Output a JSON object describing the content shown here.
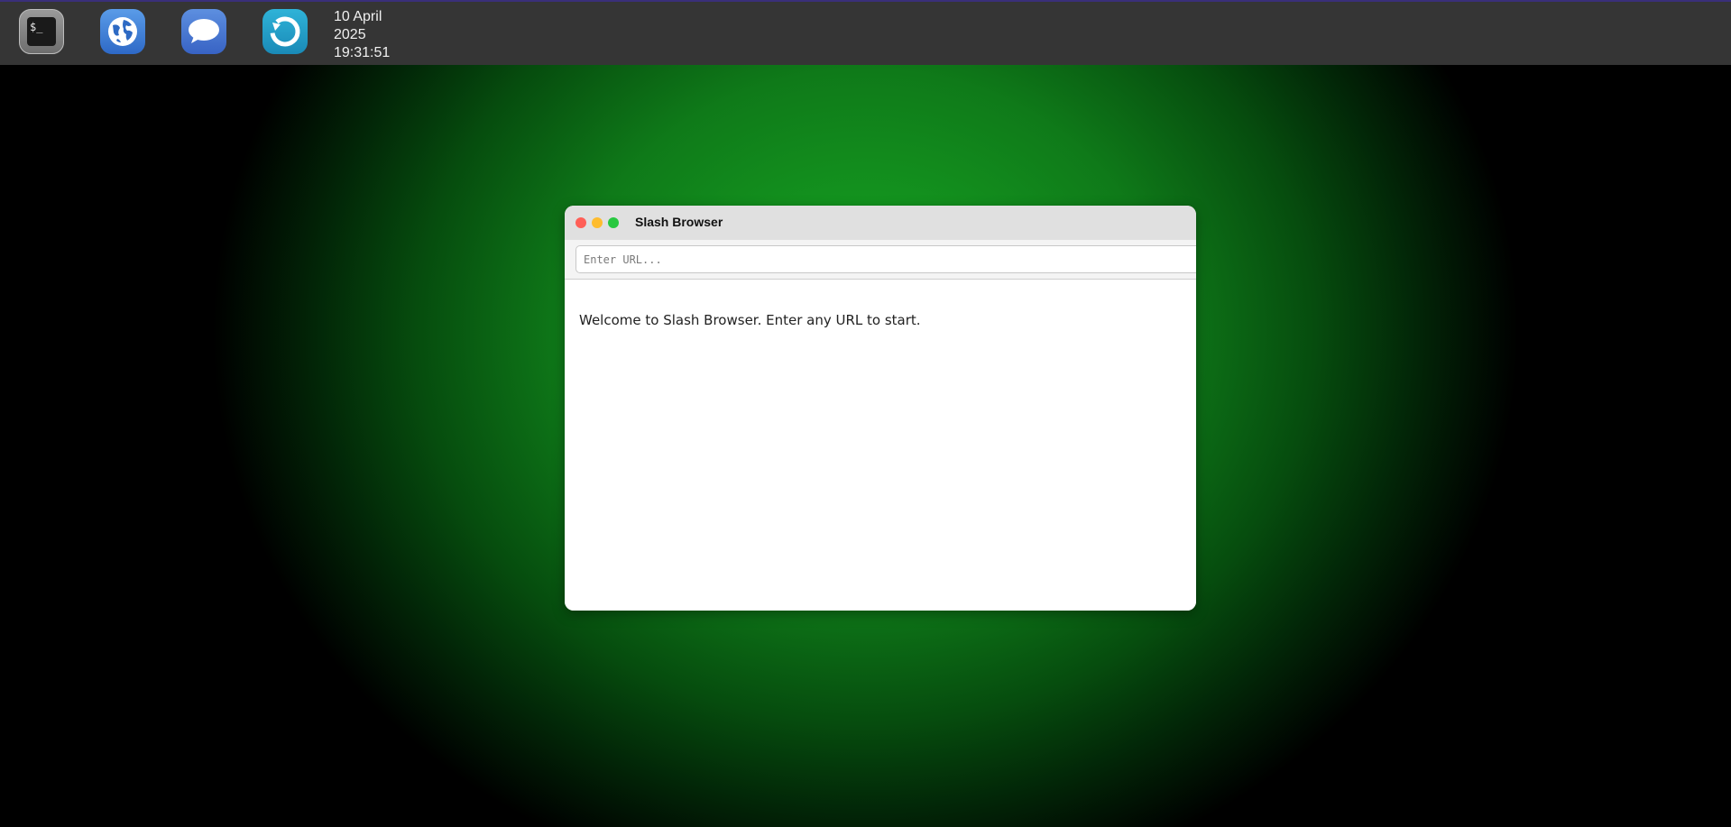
{
  "taskbar": {
    "apps": [
      {
        "name": "terminal",
        "icon": "terminal-icon",
        "glyph": "$_"
      },
      {
        "name": "browser",
        "icon": "globe-icon"
      },
      {
        "name": "messages",
        "icon": "chat-bubble-icon"
      },
      {
        "name": "refresh",
        "icon": "refresh-icon"
      }
    ],
    "clock": {
      "day_month": "10 April",
      "year": "2025",
      "time": "19:31:51"
    }
  },
  "window": {
    "title": "Slash Browser",
    "controls": {
      "close_color": "#ff5f57",
      "minimize_color": "#febc2e",
      "maximize_color": "#28c840"
    },
    "url_bar": {
      "value": "",
      "placeholder": "Enter URL..."
    },
    "content": {
      "message": "Welcome to Slash Browser. Enter any URL to start."
    }
  },
  "colors": {
    "desktop_center": "#16a02a",
    "desktop_edge": "#000000",
    "taskbar_bg": "#353535",
    "titlebar_bg": "#e0e0e0"
  }
}
